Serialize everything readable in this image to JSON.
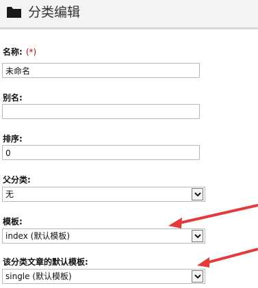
{
  "header": {
    "title": "分类编辑"
  },
  "form": {
    "name": {
      "label": "名称:",
      "required_mark": "(*)",
      "value": "未命名"
    },
    "alias": {
      "label": "别名:",
      "value": ""
    },
    "order": {
      "label": "排序:",
      "value": "0"
    },
    "parent": {
      "label": "父分类:",
      "selected": "无"
    },
    "template": {
      "label": "模板:",
      "selected": "index (默认模板)"
    },
    "article_template": {
      "label": "该分类文章的默认模板:",
      "selected": "single (默认模板)"
    }
  },
  "colors": {
    "annotation_arrow": "#e23b3b",
    "required": "#cc0000"
  }
}
